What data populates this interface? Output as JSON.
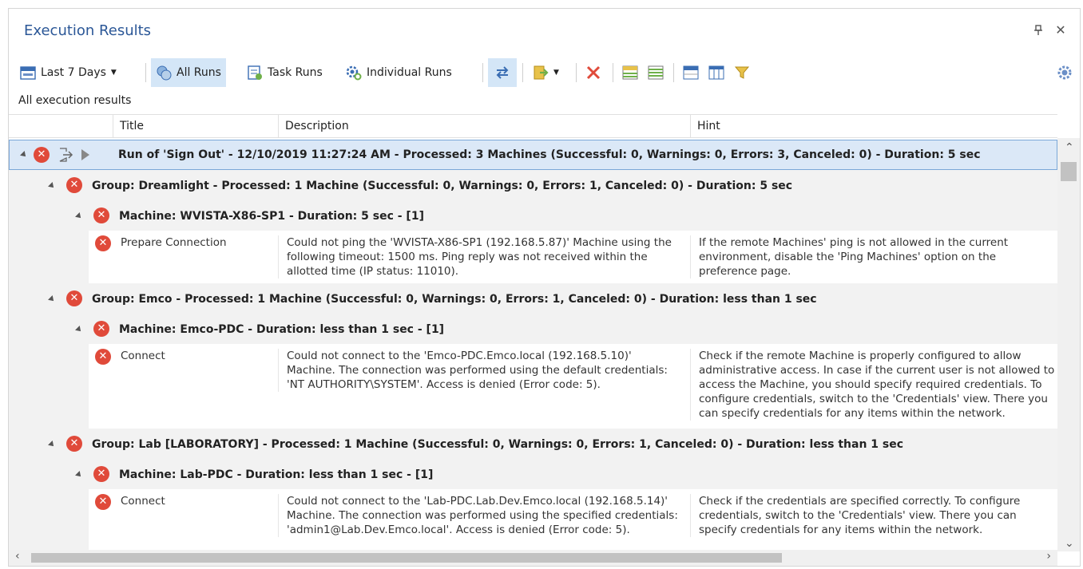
{
  "window": {
    "title": "Execution Results",
    "pin_glyph": "⊥",
    "close_glyph": "✕"
  },
  "toolbar": {
    "period_label": "Last 7 Days",
    "all_runs_label": "All Runs",
    "task_runs_label": "Task Runs",
    "individual_runs_label": "Individual Runs"
  },
  "subtitle": "All execution results",
  "columns": {
    "title": "Title",
    "description": "Description",
    "hint": "Hint"
  },
  "run": {
    "text": "Run of 'Sign Out' - 12/10/2019 11:27:24 AM - Processed: 3 Machines (Successful: 0, Warnings: 0, Errors: 3, Canceled: 0) - Duration: 5 sec"
  },
  "groups": [
    {
      "group_text": "Group: Dreamlight - Processed: 1 Machine (Successful: 0, Warnings: 0, Errors: 1, Canceled: 0) - Duration: 5 sec",
      "machine_text": "Machine: WVISTA-X86-SP1 - Duration: 5 sec - [1]",
      "title": "Prepare Connection",
      "description": "Could not ping the 'WVISTA-X86-SP1 (192.168.5.87)' Machine using the following timeout: 1500 ms. Ping reply was not received within the allotted time (IP status: 11010).",
      "hint": "If the remote Machines' ping is not allowed in the current environment, disable the 'Ping Machines' option on the preference page."
    },
    {
      "group_text": "Group: Emco - Processed: 1 Machine (Successful: 0, Warnings: 0, Errors: 1, Canceled: 0) - Duration: less than 1 sec",
      "machine_text": "Machine: Emco-PDC - Duration: less than 1 sec - [1]",
      "title": "Connect",
      "description": "Could not connect to the 'Emco-PDC.Emco.local (192.168.5.10)' Machine. The connection was performed using the default credentials: 'NT AUTHORITY\\SYSTEM'. Access is denied (Error code: 5).",
      "hint": "Check if the remote Machine is properly configured to allow administrative access. In case if the current user is not allowed to access the Machine, you should specify required credentials. To configure credentials, switch to the 'Credentials' view. There you can specify credentials for any items within the network."
    },
    {
      "group_text": "Group: Lab [LABORATORY] - Processed: 1 Machine (Successful: 0, Warnings: 0, Errors: 1, Canceled: 0) - Duration: less than 1 sec",
      "machine_text": "Machine: Lab-PDC - Duration: less than 1 sec - [1]",
      "title": "Connect",
      "description": "Could not connect to the 'Lab-PDC.Lab.Dev.Emco.local (192.168.5.14)' Machine. The connection was performed using the specified credentials: 'admin1@Lab.Dev.Emco.local'. Access is denied (Error code: 5).",
      "hint": "Check if the credentials are specified correctly. To configure credentials, switch to the 'Credentials' view. There you can specify credentials for any items within the network."
    }
  ],
  "icons": {
    "error": "error-icon",
    "sign_out": "sign-out-icon",
    "play": "play-icon",
    "settings": "gear-icon"
  },
  "colors": {
    "title": "#2b5797",
    "error": "#e04a3a",
    "selected_row": "#dbe8f7",
    "active_button": "#d4e6f7"
  }
}
